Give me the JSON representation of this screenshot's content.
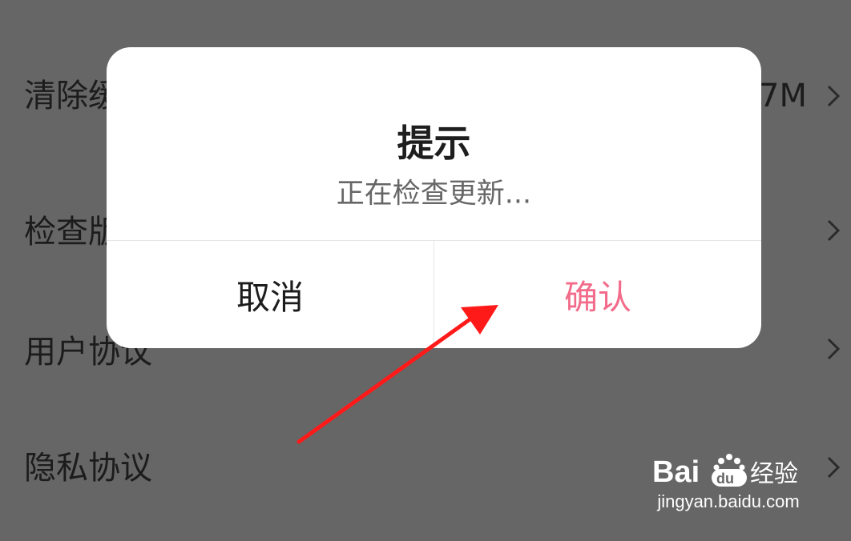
{
  "settings": {
    "items": [
      {
        "label": "清除缓存",
        "value": "7M"
      },
      {
        "label": "检查版本",
        "value": ""
      },
      {
        "label": "用户协议",
        "value": ""
      },
      {
        "label": "隐私协议",
        "value": ""
      }
    ]
  },
  "dialog": {
    "title": "提示",
    "message": "正在检查更新...",
    "cancel_label": "取消",
    "confirm_label": "确认"
  },
  "colors": {
    "overlay": "#666666",
    "confirm": "#f26b8a",
    "annotation_arrow": "#ff1a1a"
  },
  "icons": {
    "row_chevron": "chevron-right-icon",
    "annotation": "red-arrow-icon",
    "watermark": "baidu-jingyan-logo"
  },
  "watermark": {
    "logo_text": "Bai du 经验",
    "url": "jingyan.baidu.com"
  }
}
